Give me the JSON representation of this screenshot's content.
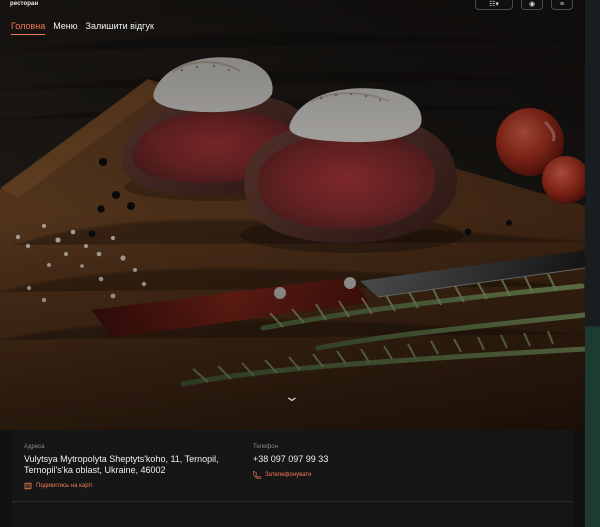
{
  "header": {
    "brand": "ресторан",
    "nav": [
      {
        "label": "Головна",
        "active": true
      },
      {
        "label": "Меню",
        "active": false
      },
      {
        "label": "Залишити відгук",
        "active": false
      }
    ],
    "actions": [
      {
        "label": "☷▾",
        "icon": "grid-icon"
      },
      {
        "label": "◉",
        "icon": "globe-icon"
      },
      {
        "label": "≡",
        "icon": "menu-icon"
      }
    ]
  },
  "hero": {
    "scroll_icon": "chevron-down-icon"
  },
  "info": {
    "address_label": "Адреса",
    "address_line_1": "Vulytsya Mytropolyta Sheptyts'koho, 11, Ternopil,",
    "address_line_2": "Ternopil's'ka oblast, Ukraine, 46002",
    "map_link": "Подивитись на карті",
    "phone_label": "Телефон",
    "phone_value": "+38 097 097 99 33",
    "call_link": "Зателефонувати"
  },
  "colors": {
    "accent": "#f37a56",
    "background": "#111111",
    "panel": "#161616",
    "rail": "#1d3b33"
  }
}
